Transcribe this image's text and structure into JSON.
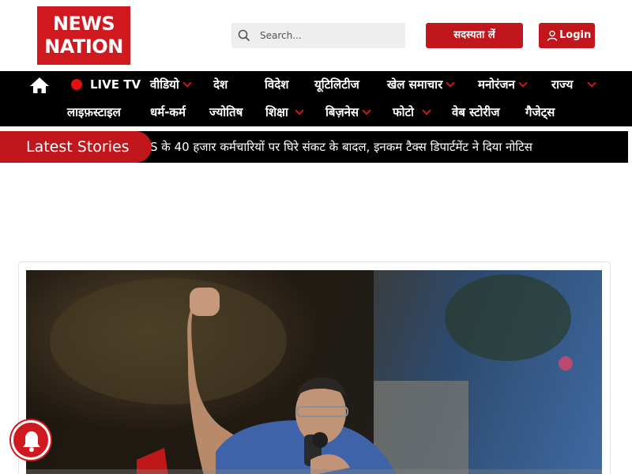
{
  "brand": {
    "logo_line1": "NEWS",
    "logo_line2": "NATION",
    "brand_color": "#d0181f"
  },
  "search": {
    "placeholder": "Search..."
  },
  "header": {
    "subscribe_label": "सदस्यता लें",
    "login_label": "Login"
  },
  "nav": {
    "row1": [
      {
        "label": "LIVE TV"
      },
      {
        "label": "वीडियो"
      },
      {
        "label": "देश"
      },
      {
        "label": "विदेश"
      },
      {
        "label": "यूटिलिटीज"
      },
      {
        "label": "खेल समाचार"
      },
      {
        "label": "मनोरंजन"
      },
      {
        "label": "राज्य"
      }
    ],
    "row2": [
      {
        "label": "लाइफ़स्टाइल"
      },
      {
        "label": "धर्म-कर्म"
      },
      {
        "label": "ज्योतिष"
      },
      {
        "label": "शिक्षा"
      },
      {
        "label": "बिज़नेस"
      },
      {
        "label": "फोटो"
      },
      {
        "label": "वेब स्टोरीज"
      },
      {
        "label": "गैजेट्स"
      }
    ]
  },
  "ticker": {
    "label": "Latest Stories",
    "text": "S के 40 हजार कर्मचारियों पर घिरे संकट के बादल, इनकम टैक्स डिपार्टमेंट ने दिया नोटिस"
  },
  "icons": {
    "search": "search-icon",
    "user": "user-icon",
    "home": "home-icon",
    "bell": "bell-icon",
    "chevron": "chevron-down-icon"
  }
}
